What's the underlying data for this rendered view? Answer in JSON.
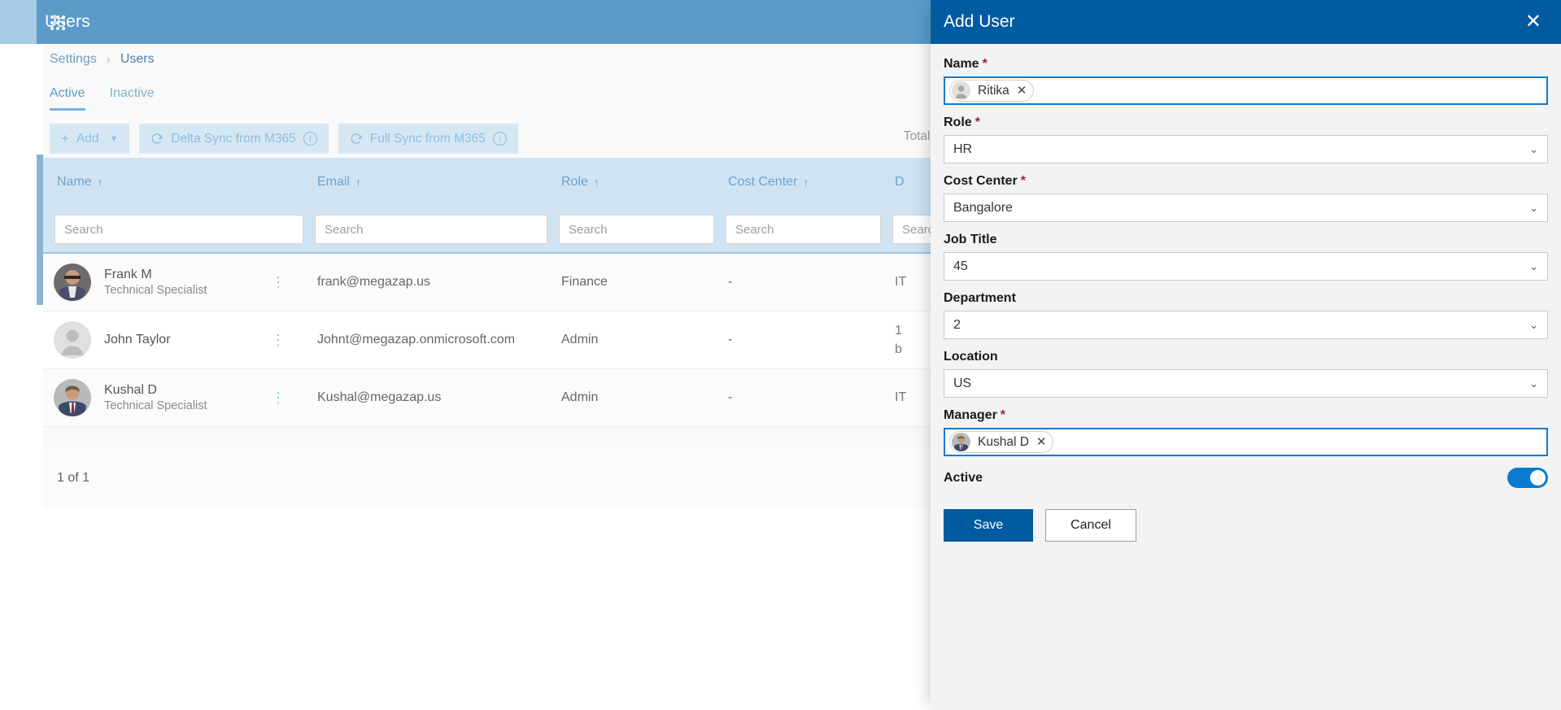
{
  "topbar": {
    "title": "Users",
    "waffle_icon": "grid-apps-icon"
  },
  "breadcrumb": {
    "parent": "Settings",
    "separator": "›",
    "current": "Users"
  },
  "tabs": [
    {
      "label": "Active",
      "active": true
    },
    {
      "label": "Inactive",
      "active": false
    }
  ],
  "toolbar": {
    "add_label": "Add",
    "add_icon": "plus-icon",
    "add_chevron": "chevron-down-icon",
    "delta_sync_label": "Delta Sync from M365",
    "full_sync_label": "Full Sync from M365",
    "sync_icon": "refresh-icon",
    "info_icon": "info-circle-icon",
    "total_users_label": "Total U"
  },
  "table": {
    "columns": [
      {
        "label": "Name",
        "sort": "↑"
      },
      {
        "label": "Email",
        "sort": "↑"
      },
      {
        "label": "Role",
        "sort": "↑"
      },
      {
        "label": "Cost Center",
        "sort": "↑"
      },
      {
        "label": "D",
        "sort": ""
      }
    ],
    "filter_placeholder": "Search",
    "rows": [
      {
        "name": "Frank M",
        "title": "Technical Specialist",
        "email": "frank@megazap.us",
        "role": "Finance",
        "cost_center": "-",
        "dept": "IT",
        "avatar": "photo-avatar"
      },
      {
        "name": "John Taylor",
        "title": "",
        "email": "Johnt@megazap.onmicrosoft.com",
        "role": "Admin",
        "cost_center": "-",
        "dept": "1\nb",
        "avatar": "default-avatar"
      },
      {
        "name": "Kushal D",
        "title": "Technical Specialist",
        "email": "Kushal@megazap.us",
        "role": "Admin",
        "cost_center": "-",
        "dept": "IT",
        "avatar": "photo-avatar"
      }
    ],
    "kebab_icon": "more-vertical-icon",
    "pagination": "1 of 1"
  },
  "panel": {
    "title": "Add User",
    "close_icon": "close-icon",
    "fields": {
      "name": {
        "label": "Name",
        "required": "*",
        "token": "Ritika",
        "remove_icon": "close-icon"
      },
      "role": {
        "label": "Role",
        "required": "*",
        "value": "HR",
        "chevron": "chevron-down-icon"
      },
      "cost_center": {
        "label": "Cost Center",
        "required": "*",
        "value": "Bangalore",
        "chevron": "chevron-down-icon"
      },
      "job_title": {
        "label": "Job Title",
        "required": "",
        "value": "45",
        "chevron": "chevron-down-icon"
      },
      "department": {
        "label": "Department",
        "required": "",
        "value": "2",
        "chevron": "chevron-down-icon"
      },
      "location": {
        "label": "Location",
        "required": "",
        "value": "US",
        "chevron": "chevron-down-icon"
      },
      "manager": {
        "label": "Manager",
        "required": "*",
        "token": "Kushal D",
        "remove_icon": "close-icon"
      },
      "active": {
        "label": "Active",
        "on": true
      }
    },
    "save_label": "Save",
    "cancel_label": "Cancel"
  },
  "colors": {
    "topbar": "#5b9bc8",
    "panel_header": "#005ba1",
    "accent": "#0b7ad1",
    "table_header": "#cfe3f3",
    "toolbar_btn": "#d6e7f4"
  }
}
